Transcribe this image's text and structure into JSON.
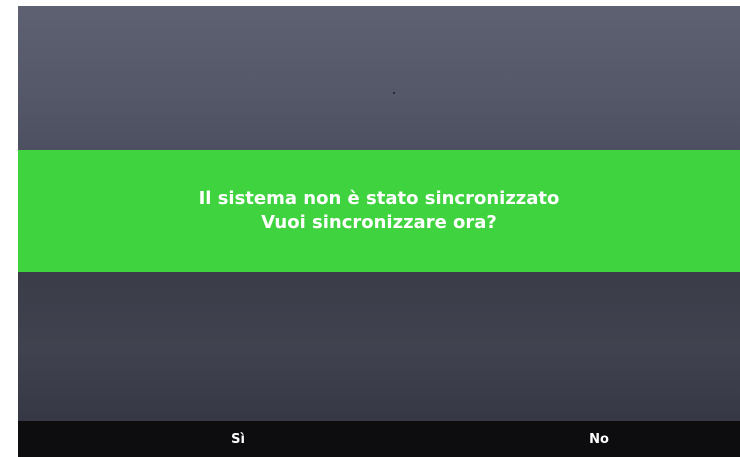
{
  "dialog": {
    "message_line1": "Il sistema non è stato sincronizzato",
    "message_line2": "Vuoi sincronizzare ora?",
    "banner_color": "#3fd33f"
  },
  "actions": {
    "yes_label": "Sì",
    "no_label": "No"
  }
}
